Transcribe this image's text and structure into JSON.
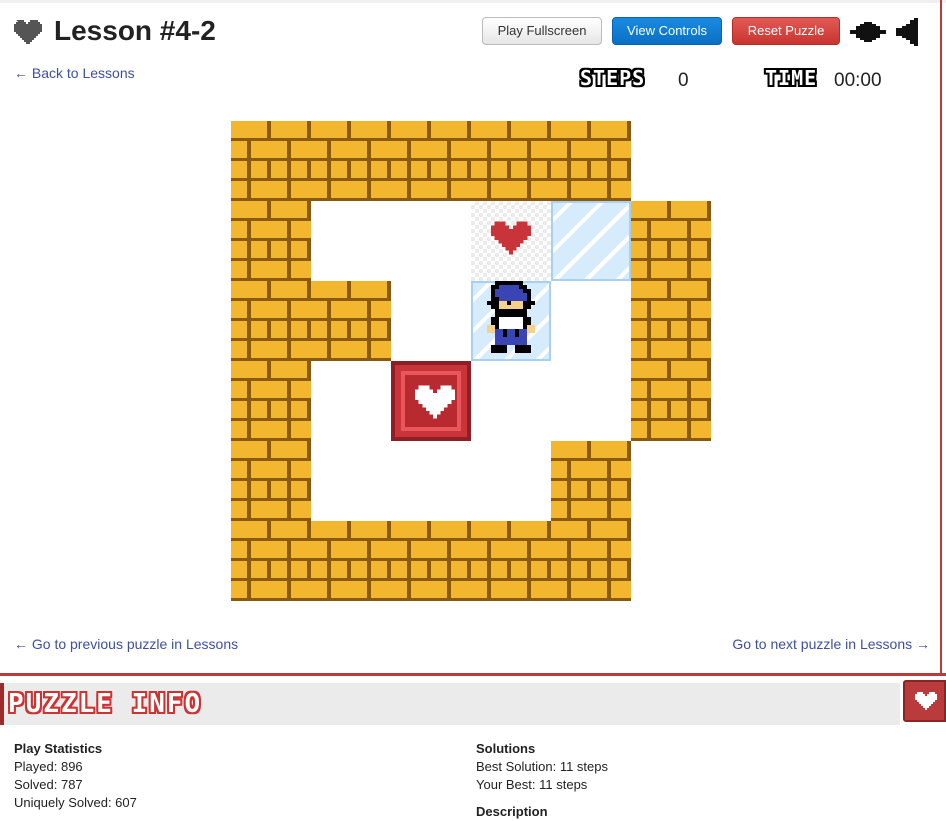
{
  "header": {
    "title": "Lesson #4-2",
    "back_link": "← Back to Lessons",
    "buttons": {
      "fullscreen": "Play Fullscreen",
      "controls": "View Controls",
      "reset": "Reset Puzzle"
    },
    "icons": [
      "heart-icon",
      "music-icon",
      "sound-icon"
    ]
  },
  "stats": {
    "steps_label": "STEPS",
    "steps_value": "0",
    "time_label": "TIME",
    "time_value": "00:00"
  },
  "nav": {
    "prev": "← Go to previous puzzle in Lessons",
    "next": "Go to next puzzle in Lessons →"
  },
  "info": {
    "title": "PUZZLE INFO",
    "play_statistics": {
      "heading": "Play Statistics",
      "played": "Played: 896",
      "solved": "Solved: 787",
      "uniquely_solved": "Uniquely Solved: 607"
    },
    "solutions": {
      "heading": "Solutions",
      "best_solution": "Best Solution: 11 steps",
      "your_best": "Your Best: 11 steps"
    },
    "description_heading": "Description"
  },
  "board": {
    "size": 6,
    "rows": [
      "WWWWW.",
      "W..G W",
      "WW.P.W",
      "W.B..W",
      "W...W.",
      "WWWWW."
    ]
  },
  "colors": {
    "link": "#3e4fa0",
    "accent_red": "#b93b3b",
    "primary_blue": "#0a6fc4",
    "brick": "#f2b72f"
  }
}
